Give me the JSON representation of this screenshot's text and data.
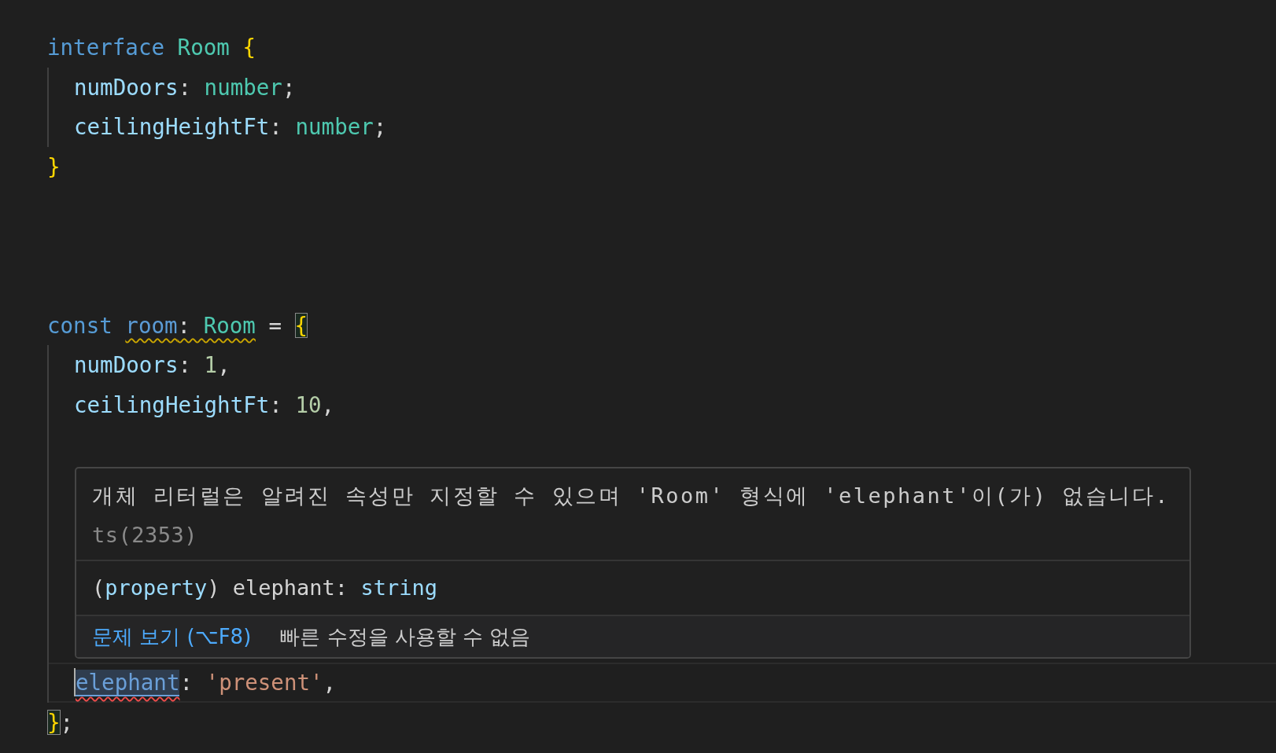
{
  "editor": {
    "lines": [
      {
        "kind": "code",
        "tokens": [
          {
            "kind": "keyword",
            "text": "interface "
          },
          {
            "kind": "type",
            "text": "Room "
          },
          {
            "kind": "brace",
            "text": "{"
          }
        ],
        "children": [
          {
            "kind": "code",
            "tokens": [
              {
                "kind": "property",
                "text": "numDoors"
              },
              {
                "kind": "punct",
                "text": ": "
              },
              {
                "kind": "type",
                "text": "number"
              },
              {
                "kind": "punct",
                "text": ";"
              }
            ]
          },
          {
            "kind": "code",
            "tokens": [
              {
                "kind": "property",
                "text": "ceilingHeightFt"
              },
              {
                "kind": "punct",
                "text": ": "
              },
              {
                "kind": "type",
                "text": "number"
              },
              {
                "kind": "punct",
                "text": ";"
              }
            ]
          }
        ]
      },
      {
        "kind": "code",
        "tokens": [
          {
            "kind": "brace",
            "text": "}"
          }
        ]
      },
      {
        "kind": "blank"
      },
      {
        "kind": "blank"
      },
      {
        "kind": "blank"
      },
      {
        "kind": "code",
        "tokens": [
          {
            "kind": "keyword",
            "text": "const "
          },
          {
            "kind": "warning-range",
            "parts": [
              {
                "kind": "variable",
                "text": "room"
              },
              {
                "kind": "punct",
                "text": ": "
              },
              {
                "kind": "type",
                "text": "Room"
              }
            ]
          },
          {
            "kind": "punct",
            "text": " = "
          },
          {
            "kind": "brace-match",
            "text": "{"
          }
        ],
        "children": [
          {
            "kind": "code",
            "tokens": [
              {
                "kind": "property",
                "text": "numDoors"
              },
              {
                "kind": "punct",
                "text": ": "
              },
              {
                "kind": "number",
                "text": "1"
              },
              {
                "kind": "punct",
                "text": ","
              }
            ]
          },
          {
            "kind": "code",
            "tokens": [
              {
                "kind": "property",
                "text": "ceilingHeightFt"
              },
              {
                "kind": "punct",
                "text": ": "
              },
              {
                "kind": "number",
                "text": "10"
              },
              {
                "kind": "punct",
                "text": ","
              }
            ]
          },
          {
            "kind": "blank"
          },
          {
            "kind": "blank"
          },
          {
            "kind": "blank"
          },
          {
            "kind": "blank"
          },
          {
            "kind": "blank"
          },
          {
            "kind": "blank"
          },
          {
            "kind": "cursor",
            "tokens": [
              {
                "kind": "error-link",
                "text": "elephant"
              },
              {
                "kind": "punct",
                "text": ": "
              },
              {
                "kind": "string",
                "text": "'present'"
              },
              {
                "kind": "punct",
                "text": ","
              }
            ]
          }
        ]
      },
      {
        "kind": "code",
        "tokens": [
          {
            "kind": "brace-match",
            "text": "}"
          },
          {
            "kind": "punct",
            "text": ";"
          }
        ]
      }
    ]
  },
  "hover": {
    "message": "개체 리터럴은 알려진 속성만 지정할 수 있으며 'Room' 형식에 'elephant'이(가) 없습니다.",
    "code": "ts(2353)",
    "signature": [
      {
        "kind": "type-keyword",
        "text": "("
      },
      {
        "kind": "property",
        "text": "property"
      },
      {
        "kind": "plain",
        "text": ") elephant: "
      },
      {
        "kind": "property",
        "text": "string"
      }
    ],
    "view_problem": "문제 보기 (⌥F8)",
    "quick_fix": "빠른 수정을 사용할 수 없음"
  }
}
